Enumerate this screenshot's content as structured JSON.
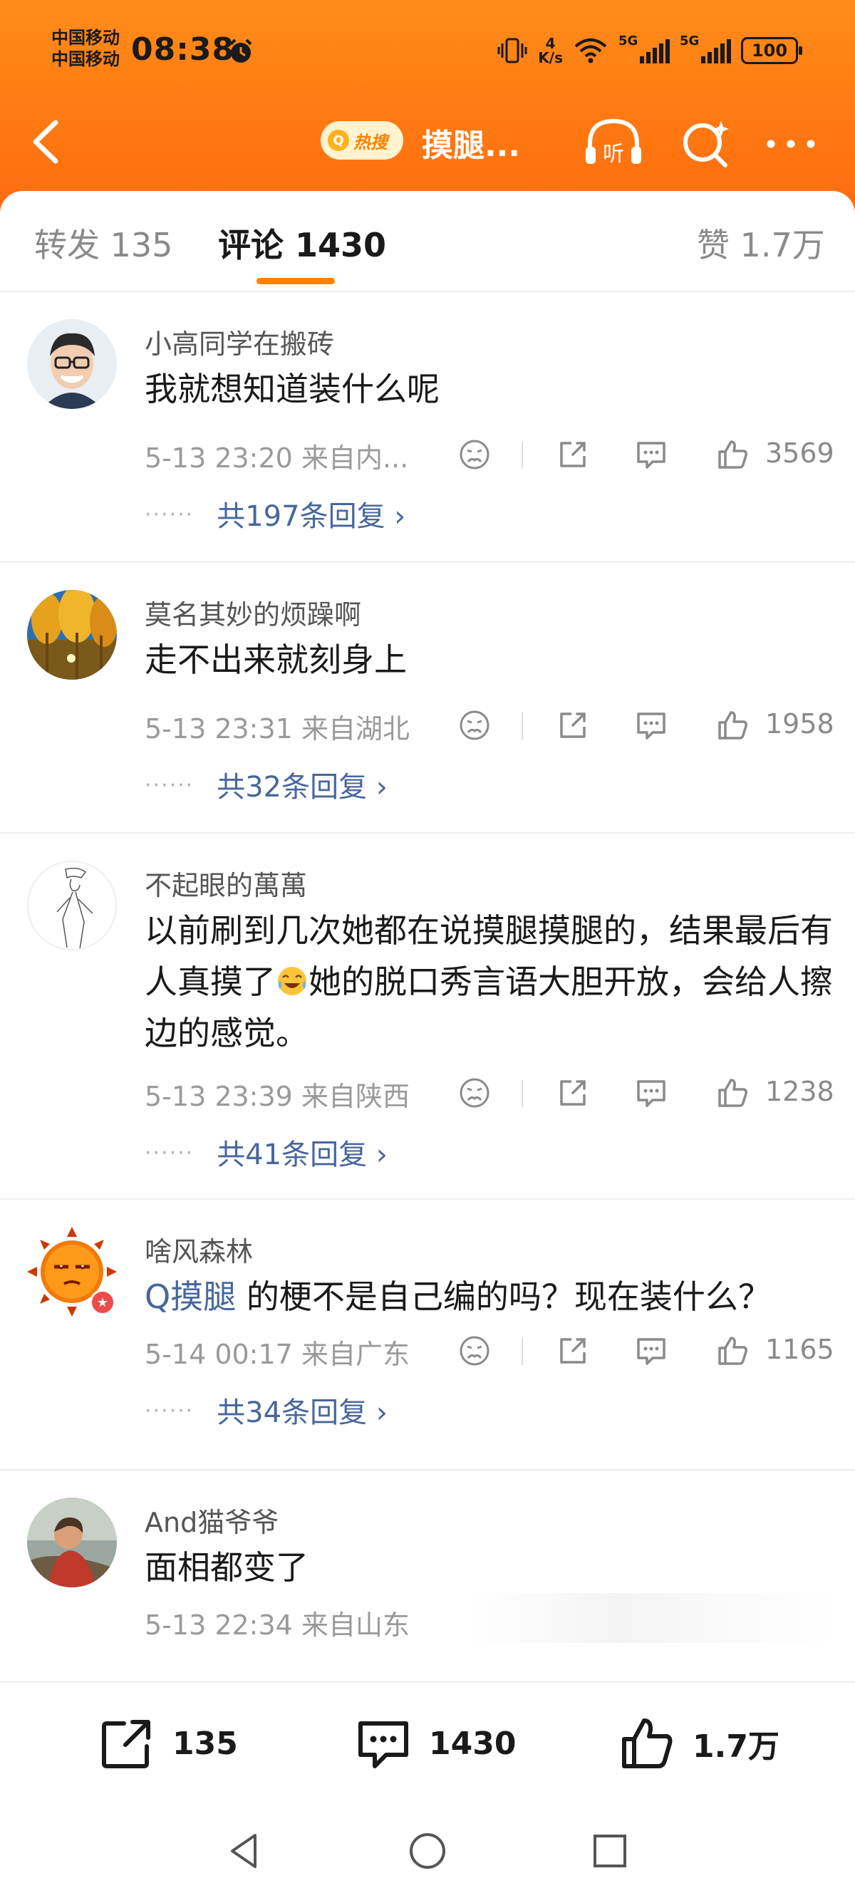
{
  "status_bar": {
    "carrier_1": "中国移动",
    "carrier_2": "中国移动",
    "time": "08:38",
    "net_speed_value": "4",
    "net_speed_unit": "K/s",
    "signal_1": "5G",
    "signal_2": "5G",
    "battery": "100"
  },
  "nav": {
    "hot_tag": "热搜",
    "title": "摸腿...",
    "listen_label": "听"
  },
  "tabs": [
    {
      "label": "转发 135"
    },
    {
      "label": "评论 1430"
    },
    {
      "label": "赞 1.7万"
    }
  ],
  "comments": [
    {
      "username": "小高同学在搬砖",
      "content": "我就想知道装什么呢",
      "time": "5-13 23:20",
      "location": "来自内...",
      "likes": "3569",
      "replies": "共197条回复",
      "avatar": "person-glasses"
    },
    {
      "username": "莫名其妙的烦躁啊",
      "content": "走不出来就刻身上",
      "time": "5-13 23:31",
      "location": "来自湖北",
      "likes": "1958",
      "replies": "共32条回复",
      "avatar": "autumn-trees"
    },
    {
      "username": "不起眼的萬萬",
      "content_a": "以前刷到几次她都在说摸腿摸腿的，结果最后有人真摸了",
      "content_b": "她的脱口秀言语大胆开放，会给人擦边的感觉。",
      "time": "5-13 23:39",
      "location": "来自陕西",
      "likes": "1238",
      "replies": "共41条回复",
      "avatar": "sketch-figure",
      "emoji": "laughing-crying-emoji"
    },
    {
      "username": "啥风森林",
      "topic": "摸腿",
      "content_rest": " 的梗不是自己编的吗？现在装什么？",
      "time": "5-14 00:17",
      "location": "来自广东",
      "likes": "1165",
      "replies": "共34条回复",
      "avatar": "sun-character"
    },
    {
      "username": "And猫爷爷",
      "content": "面相都变了",
      "time": "5-13 22:34",
      "location": "来自山东",
      "avatar": "person-photo"
    }
  ],
  "bottom_bar": {
    "repost_count": "135",
    "comment_count": "1430",
    "like_count": "1.7万"
  },
  "colors": {
    "header_orange": "#ff7a12",
    "accent": "#ff8200",
    "link_blue": "#47679c"
  }
}
